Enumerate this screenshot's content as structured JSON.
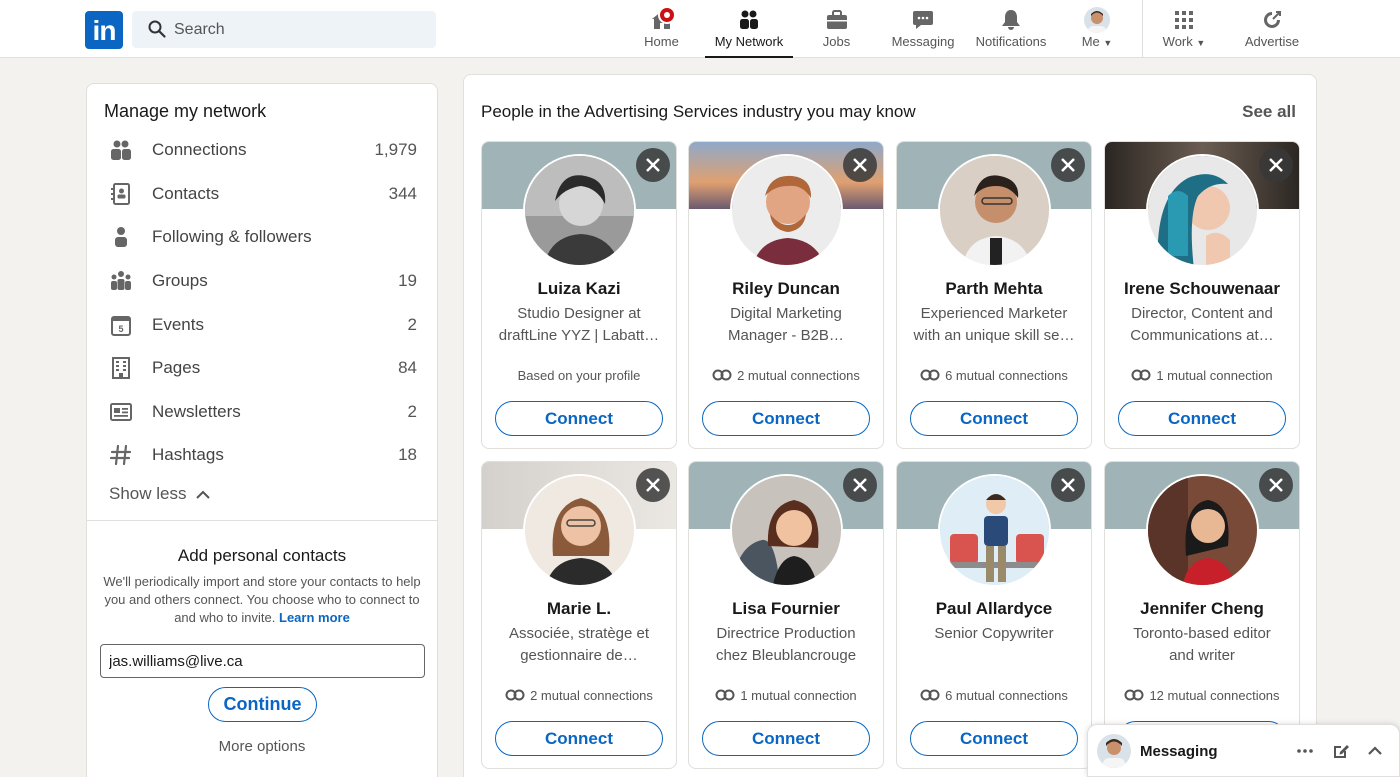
{
  "search": {
    "placeholder": "Search"
  },
  "nav": {
    "home": "Home",
    "network": "My Network",
    "jobs": "Jobs",
    "messaging": "Messaging",
    "notifications": "Notifications",
    "me": "Me",
    "work": "Work",
    "advertise": "Advertise"
  },
  "sidebar": {
    "title": "Manage my network",
    "items": [
      {
        "label": "Connections",
        "count": "1,979",
        "icon": "people-icon"
      },
      {
        "label": "Contacts",
        "count": "344",
        "icon": "contact-card-icon"
      },
      {
        "label": "Following & followers",
        "count": "",
        "icon": "person-icon"
      },
      {
        "label": "Groups",
        "count": "19",
        "icon": "groups-icon"
      },
      {
        "label": "Events",
        "count": "2",
        "icon": "calendar-icon"
      },
      {
        "label": "Pages",
        "count": "84",
        "icon": "building-icon"
      },
      {
        "label": "Newsletters",
        "count": "2",
        "icon": "newsletter-icon"
      },
      {
        "label": "Hashtags",
        "count": "18",
        "icon": "hashtag-icon"
      }
    ],
    "show_less": "Show less",
    "add_contacts": {
      "title": "Add personal contacts",
      "description": "We'll periodically import and store your contacts to help you and others connect. You choose who to connect to and who to invite.",
      "learn_more": "Learn more",
      "email_value": "jas.williams@live.ca",
      "continue": "Continue",
      "more_options": "More options"
    }
  },
  "main": {
    "title": "People in the Advertising Services industry you may know",
    "see_all": "See all",
    "connect_label": "Connect",
    "people": [
      {
        "name": "Luiza Kazi",
        "headline": "Studio Designer at draftLine YYZ | Labatt…",
        "meta": "Based on your profile",
        "mutual": false
      },
      {
        "name": "Riley Duncan",
        "headline": "Digital Marketing Manager - B2B…",
        "meta": "2 mutual connections",
        "mutual": true
      },
      {
        "name": "Parth Mehta",
        "headline": "Experienced Marketer with an unique skill se…",
        "meta": "6 mutual connections",
        "mutual": true
      },
      {
        "name": "Irene Schouwenaar",
        "headline": "Director, Content and Communications at…",
        "meta": "1 mutual connection",
        "mutual": true
      },
      {
        "name": "Marie L.",
        "headline": "Associée, stratège et gestionnaire de…",
        "meta": "2 mutual connections",
        "mutual": true
      },
      {
        "name": "Lisa Fournier",
        "headline": "Directrice Production chez Bleublancrouge",
        "meta": "1 mutual connection",
        "mutual": true
      },
      {
        "name": "Paul Allardyce",
        "headline": "Senior Copywriter",
        "meta": "6 mutual connections",
        "mutual": true
      },
      {
        "name": "Jennifer Cheng",
        "headline": "Toronto-based editor and writer",
        "meta": "12 mutual connections",
        "mutual": true
      }
    ]
  },
  "messaging_bar": {
    "label": "Messaging"
  },
  "colors": {
    "brand": "#0a66c2",
    "background": "#f3f2ef",
    "alert": "#cc1016"
  }
}
